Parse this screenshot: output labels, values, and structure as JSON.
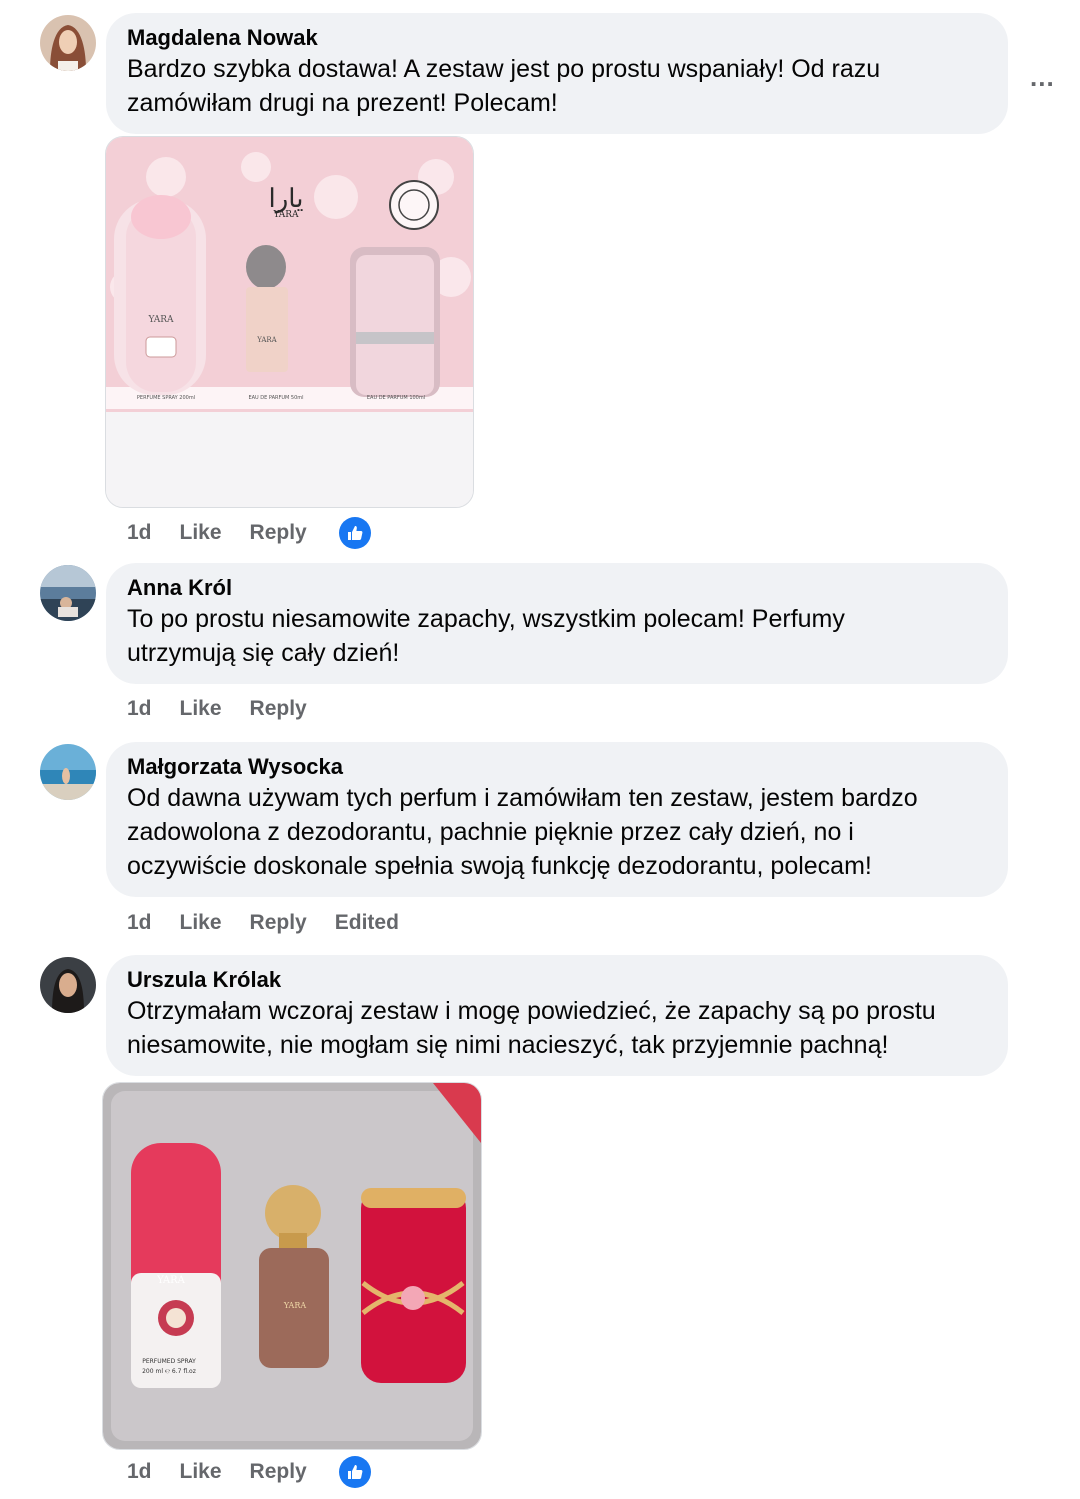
{
  "comments": [
    {
      "author": "Magdalena Nowak",
      "text_lines": [
        "Bardzo szybka dostawa! A zestaw jest po prostu wspaniały! Od razu",
        "zamówiłam drugi na prezent! Polecam!"
      ],
      "time": "1d",
      "like": "Like",
      "reply": "Reply"
    },
    {
      "author": "Anna Król",
      "text_lines": [
        "To po prostu niesamowite zapachy, wszystkim polecam! Perfumy",
        "utrzymują się cały dzień!"
      ],
      "time": "1d",
      "like": "Like",
      "reply": "Reply"
    },
    {
      "author": "Małgorzata Wysocka",
      "text_lines": [
        "Od dawna używam tych perfum i zamówiłam ten zestaw, jestem bardzo",
        "zadowolona z dezodorantu, pachnie pięknie przez cały dzień, no i",
        "oczywiście doskonale spełnia swoją funkcję dezodorantu, polecam!"
      ],
      "time": "1d",
      "like": "Like",
      "reply": "Reply",
      "edited": "Edited"
    },
    {
      "author": "Urszula Królak",
      "text_lines": [
        "Otrzymałam wczoraj zestaw i mogę powiedzieć, że zapachy są po prostu",
        "niesamowite, nie mogłam się nimi nacieszyć, tak przyjemnie pachną!"
      ],
      "time": "1d",
      "like": "Like",
      "reply": "Reply"
    }
  ],
  "more_menu": "...",
  "photo1": {
    "brand": "YARA",
    "labels": [
      "PERFUME SPRAY 200ml",
      "EAU DE PARFUM 50ml",
      "EAU DE PARFUM 100ml"
    ]
  },
  "photo2": {
    "brand": "YARA",
    "spray_label": "PERFUMED SPRAY",
    "spray_size": "200 ml ℮ 6.7 fl.oz"
  },
  "reaction_icon": "thumbs-up-icon",
  "colors": {
    "bubble": "#f0f2f5",
    "meta": "#65676b",
    "like_blue": "#1877f2"
  }
}
